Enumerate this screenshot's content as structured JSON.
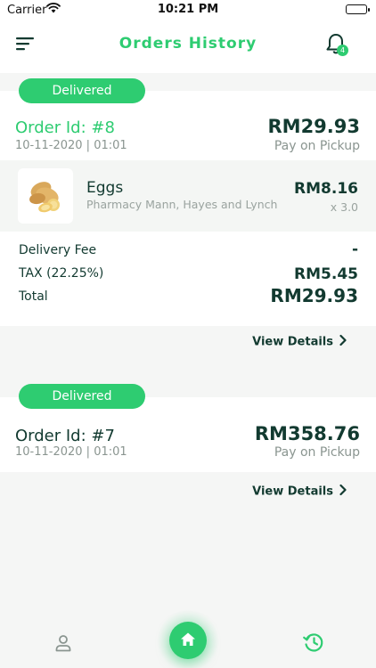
{
  "status_bar": {
    "carrier": "Carrier",
    "time": "10:21 PM"
  },
  "header": {
    "title": "Orders History",
    "notification_count": "4"
  },
  "orders": [
    {
      "status": "Delivered",
      "order_id": "Order Id: #8",
      "date": "10-11-2020 | 01:01",
      "total": "RM29.93",
      "payment": "Pay on Pickup",
      "items": [
        {
          "name": "Eggs",
          "store": "Pharmacy Mann, Hayes and Lynch",
          "price": "RM8.16",
          "quantity": "x 3.0"
        }
      ],
      "summary": {
        "delivery_fee_label": "Delivery Fee",
        "delivery_fee_value": "-",
        "tax_label": "TAX (22.25%)",
        "tax_value": "RM5.45",
        "total_label": "Total",
        "total_value": "RM29.93"
      },
      "view_details": "View Details"
    },
    {
      "status": "Delivered",
      "order_id": "Order Id: #7",
      "date": "10-11-2020 | 01:01",
      "total": "RM358.76",
      "payment": "Pay on Pickup",
      "view_details": "View Details"
    }
  ],
  "bottom_nav": {
    "icons": [
      "user-icon",
      "home-icon",
      "history-icon"
    ],
    "active": "home"
  },
  "colors": {
    "accent": "#2ecc71",
    "text_dark": "#123a30",
    "text_muted": "#8a9590"
  }
}
